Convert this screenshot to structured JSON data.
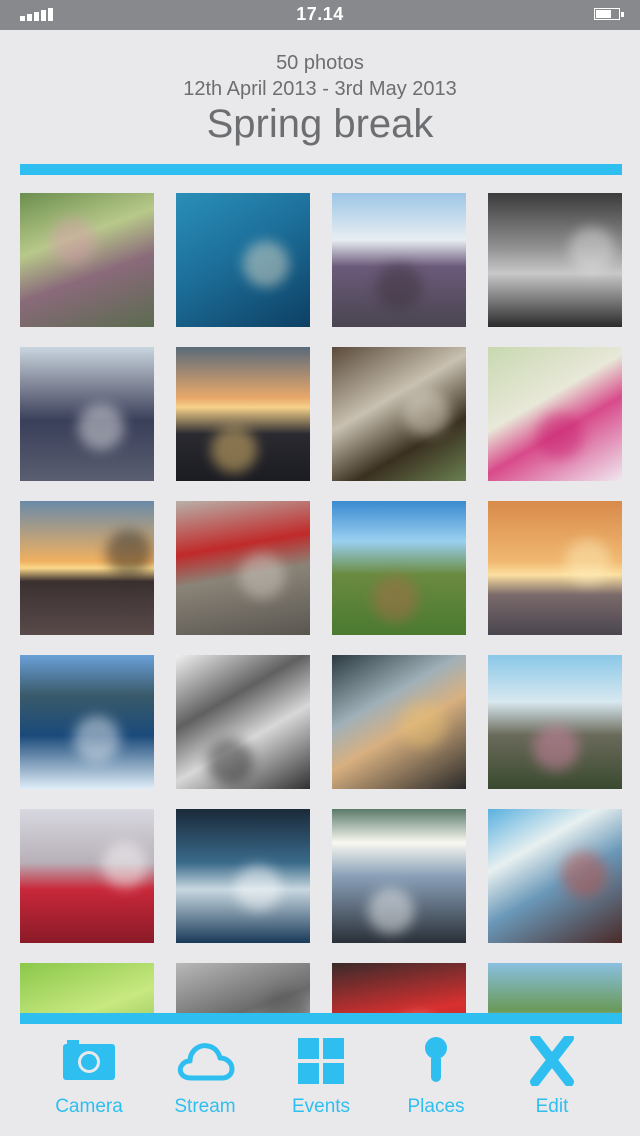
{
  "status_bar": {
    "time": "17.14"
  },
  "album": {
    "photo_count": "50 photos",
    "date_range": "12th April 2013 - 3rd May 2013",
    "title": "Spring break"
  },
  "colors": {
    "accent": "#2ebff0",
    "background": "#e9e9eb",
    "status_bar": "#87898c",
    "text": "#6d6e71"
  },
  "photos": [
    {
      "name": "photo-purple-flower-bud",
      "bg": "linear-gradient(160deg,#6b8f4e 0%,#b8c98a 35%,#8a6a7a 60%,#5b6b50 100%)",
      "accent": "#d99bb0"
    },
    {
      "name": "photo-water-reflection",
      "bg": "linear-gradient(150deg,#2a8fb8 0%,#1c6f9a 45%,#0e3f63 100%)",
      "accent": "#f3ead0"
    },
    {
      "name": "photo-road-tunnel-wall",
      "bg": "linear-gradient(180deg,#9cc6e6 0%,#e8eef2 35%,#6b5a7a 55%,#4a4550 100%)",
      "accent": "#3a2f38"
    },
    {
      "name": "photo-waterfall-bw",
      "bg": "linear-gradient(180deg,#3b3b3b 0%,#8f8f8f 40%,#c8c8c8 60%,#2b2b2b 100%)",
      "accent": "#e6e6e6"
    },
    {
      "name": "photo-road-center-line",
      "bg": "linear-gradient(180deg,#c9d6e0 0%,#8a8fa0 25%,#3a3f5a 55%,#5a5e70 100%)",
      "accent": "#f2f2f2"
    },
    {
      "name": "photo-sunset-pier",
      "bg": "linear-gradient(180deg,#5a6a7a 0%,#e9a86a 38%,#f6d18a 45%,#2a2a30 65%,#1b1b22 100%)",
      "accent": "#ffd57a"
    },
    {
      "name": "photo-stream-rocks",
      "bg": "linear-gradient(150deg,#5a4a3a 0%,#c8c0b0 40%,#3a3020 70%,#6a8050 100%)",
      "accent": "#e8e0d0"
    },
    {
      "name": "photo-pink-lily",
      "bg": "linear-gradient(150deg,#c8d8b0 0%,#e8e8d8 40%,#d84a8a 60%,#f0e8f0 100%)",
      "accent": "#c81e6e"
    },
    {
      "name": "photo-sunset-beacon",
      "bg": "linear-gradient(180deg,#6a8aa8 0%,#f0b060 45%,#fbd88a 50%,#3a3030 60%,#5a4a4a 100%)",
      "accent": "#1b1b1b"
    },
    {
      "name": "photo-red-house-gravel",
      "bg": "linear-gradient(170deg,#b8b0a8 0%,#c02a2a 35%,#8a8478 55%,#5a5550 100%)",
      "accent": "#d8d0c8"
    },
    {
      "name": "photo-green-hills",
      "bg": "linear-gradient(180deg,#3a8ad0 0%,#9ad0f0 30%,#6a8a40 55%,#4a7a30 100%)",
      "accent": "#b06a4a"
    },
    {
      "name": "photo-sunset-sea",
      "bg": "linear-gradient(180deg,#d88a4a 0%,#f0b870 45%,#fde0a0 55%,#7a6a6a 70%,#4a4550 100%)",
      "accent": "#fff0c0"
    },
    {
      "name": "photo-boat-wake",
      "bg": "linear-gradient(180deg,#6aa0d8 0%,#3a5a6a 30%,#1a4a7a 60%,#e0eef8 100%)",
      "accent": "#ffffff"
    },
    {
      "name": "photo-barbed-wire-bw",
      "bg": "linear-gradient(150deg,#f0f0f0 0%,#606060 35%,#d8d8d8 60%,#303030 100%)",
      "accent": "#1a1a1a"
    },
    {
      "name": "photo-woman-in-boat",
      "bg": "linear-gradient(150deg,#2a3a40 0%,#a0b0b8 35%,#d8b080 55%,#2a2a2a 100%)",
      "accent": "#e8c070"
    },
    {
      "name": "photo-coastal-flowers",
      "bg": "linear-gradient(180deg,#8ac8e8 0%,#d8e8f0 35%,#6a6a5a 60%,#3a4a30 100%)",
      "accent": "#e08ab0"
    },
    {
      "name": "photo-red-sign-129",
      "bg": "linear-gradient(180deg,#d8d8e0 0%,#b8b0b8 40%,#c8283a 60%,#8a1a28 100%)",
      "accent": "#ffffff"
    },
    {
      "name": "photo-sea-splash",
      "bg": "linear-gradient(180deg,#1a2a3a 0%,#3a6a8a 40%,#c8d8e0 60%,#1a3a5a 100%)",
      "accent": "#ffffff"
    },
    {
      "name": "photo-sun-coast-boats",
      "bg": "linear-gradient(180deg,#5a7a6a 0%,#f8f8f0 25%,#8aa0b8 50%,#2a3038 100%)",
      "accent": "#ffffff"
    },
    {
      "name": "photo-utility-pole",
      "bg": "linear-gradient(150deg,#5ab0e0 0%,#e8f0f0 30%,#6a98b8 55%,#4a2a28 100%)",
      "accent": "#c84a3a"
    },
    {
      "name": "photo-green-leaf",
      "bg": "linear-gradient(160deg,#8ac84a 0%,#c8e880 40%,#5a9a30 100%)",
      "accent": "#e8f8b0"
    },
    {
      "name": "photo-slug-gravel-bw",
      "bg": "linear-gradient(160deg,#b8b8b8 0%,#6a6a6a 40%,#d0d0d0 70%,#3a3a3a 100%)",
      "accent": "#505050"
    },
    {
      "name": "photo-red-car",
      "bg": "linear-gradient(170deg,#3a2a2a 0%,#d83030 40%,#a82020 70%,#4a4040 100%)",
      "accent": "#f0c0c0"
    },
    {
      "name": "photo-blossom-houses",
      "bg": "linear-gradient(180deg,#8ac0e0 0%,#6a9a5a 35%,#e8d8e8 55%,#a06a8a 100%)",
      "accent": "#f8f0f8"
    }
  ],
  "tabs": [
    {
      "label": "Camera",
      "icon": "camera-icon"
    },
    {
      "label": "Stream",
      "icon": "cloud-icon"
    },
    {
      "label": "Events",
      "icon": "grid-icon"
    },
    {
      "label": "Places",
      "icon": "pin-icon"
    },
    {
      "label": "Edit",
      "icon": "x-icon"
    }
  ]
}
